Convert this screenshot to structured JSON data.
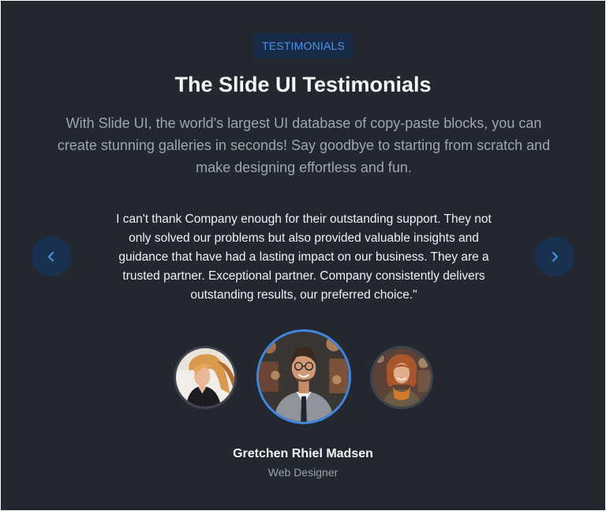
{
  "section": {
    "badge": "TESTIMONIALS",
    "title": "The Slide UI Testimonials",
    "subtitle": "With Slide UI, the world's largest UI database of copy-paste blocks, you can create stunning galleries in seconds! Say goodbye to starting from scratch and make designing effortless and fun."
  },
  "testimonial": {
    "quote": "I can't thank Company enough for their outstanding support. They not only solved our problems but also provided valuable insights and guidance that have had a lasting impact on our business. They are a trusted partner. Exceptional partner. Company consistently delivers outstanding results, our preferred choice.\"",
    "name": "Gretchen Rhiel Madsen",
    "role": "Web Designer"
  },
  "navigation": {
    "prev_icon": "chevron-left-icon",
    "next_icon": "chevron-right-icon"
  },
  "avatars": [
    {
      "icon": "woman-portrait",
      "state": "inactive"
    },
    {
      "icon": "man-portrait",
      "state": "active"
    },
    {
      "icon": "woman-portrait",
      "state": "inactive"
    }
  ],
  "colors": {
    "background": "#232830",
    "accent": "#3f86e0",
    "badge_bg": "#172b48",
    "nav_bg": "#183150"
  }
}
